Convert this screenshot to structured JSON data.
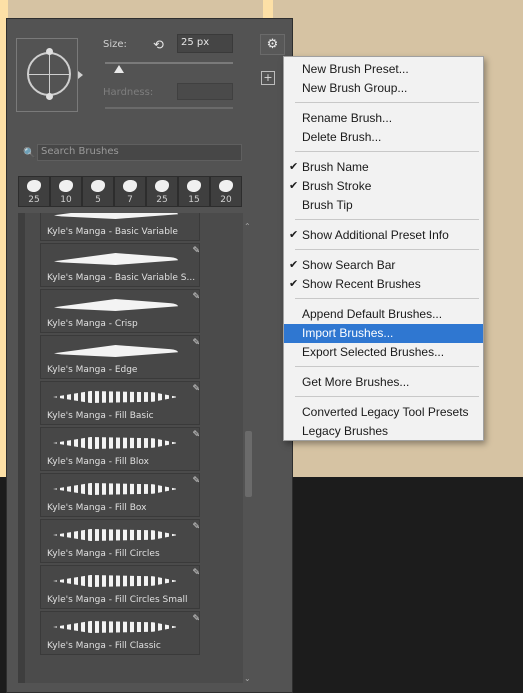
{
  "panel": {
    "size_label": "Size:",
    "size_value": "25 px",
    "hardness_label": "Hardness:",
    "search_placeholder": "Search Brushes"
  },
  "recent_brushes": [
    "25",
    "10",
    "5",
    "7",
    "25",
    "15",
    "20"
  ],
  "brush_list": [
    "Kyle's Manga - Basic Variable",
    "Kyle's Manga - Basic Variable S...",
    "Kyle's Manga - Crisp",
    "Kyle's Manga - Edge",
    "Kyle's Manga - Fill Basic",
    "Kyle's Manga - Fill Blox",
    "Kyle's Manga - Fill Box",
    "Kyle's Manga - Fill Circles",
    "Kyle's Manga - Fill Circles Small",
    "Kyle's Manga - Fill Classic"
  ],
  "menu": {
    "items": [
      {
        "label": "New Brush Preset...",
        "checked": false
      },
      {
        "label": "New Brush Group...",
        "checked": false
      },
      {
        "label": "Rename Brush...",
        "checked": false
      },
      {
        "label": "Delete Brush...",
        "checked": false
      },
      {
        "label": "Brush Name",
        "checked": true
      },
      {
        "label": "Brush Stroke",
        "checked": true
      },
      {
        "label": "Brush Tip",
        "checked": false
      },
      {
        "label": "Show Additional Preset Info",
        "checked": true
      },
      {
        "label": "Show Search Bar",
        "checked": true
      },
      {
        "label": "Show Recent Brushes",
        "checked": true
      },
      {
        "label": "Append Default Brushes...",
        "checked": false
      },
      {
        "label": "Import Brushes...",
        "checked": false,
        "selected": true
      },
      {
        "label": "Export Selected Brushes...",
        "checked": false
      },
      {
        "label": "Get More Brushes...",
        "checked": false
      },
      {
        "label": "Converted Legacy Tool Presets",
        "checked": false
      },
      {
        "label": "Legacy Brushes",
        "checked": false
      }
    ]
  },
  "colors": {
    "menu_highlight": "#2f77d1",
    "panel_bg": "#535353",
    "menu_bg": "#f2f2f2"
  }
}
